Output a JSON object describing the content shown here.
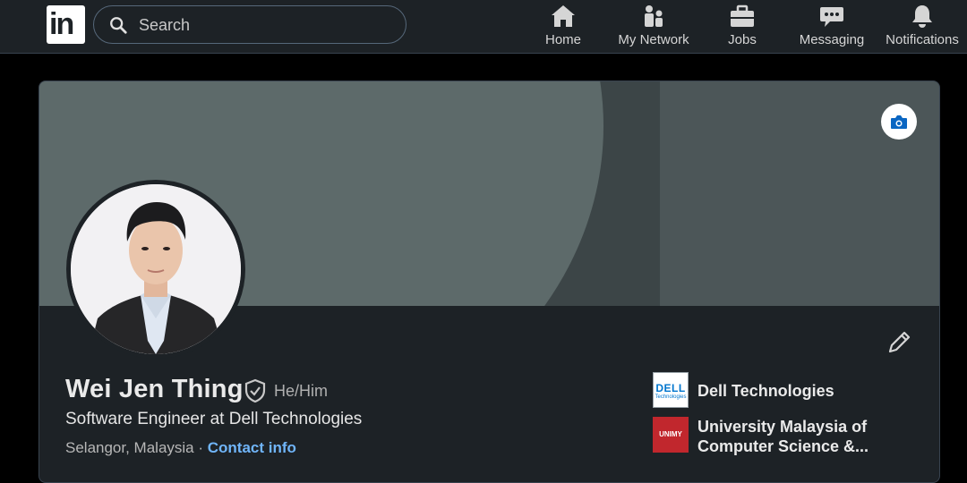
{
  "nav": {
    "logo_text": "in",
    "search_placeholder": "Search",
    "items": [
      {
        "label": "Home",
        "icon": "home-icon"
      },
      {
        "label": "My Network",
        "icon": "network-icon"
      },
      {
        "label": "Jobs",
        "icon": "briefcase-icon"
      },
      {
        "label": "Messaging",
        "icon": "messaging-icon"
      },
      {
        "label": "Notifications",
        "icon": "bell-icon"
      }
    ]
  },
  "profile": {
    "name": "Wei Jen Thing",
    "pronouns": "He/Him",
    "headline": "Software Engineer at Dell Technologies",
    "location": "Selangor, Malaysia",
    "separator": " · ",
    "contact_link": "Contact info",
    "organizations": [
      {
        "name": "Dell Technologies",
        "logo_text": "DELL",
        "logo_subtext": "Technologies"
      },
      {
        "name": "University Malaysia of Computer Science &...",
        "logo_text": "UNIMY"
      }
    ]
  },
  "colors": {
    "nav_bg": "#1d2226",
    "card_bg": "#1d2226",
    "link": "#70b5f9",
    "camera_icon": "#0a66c2",
    "unimy_red": "#c1272d"
  }
}
